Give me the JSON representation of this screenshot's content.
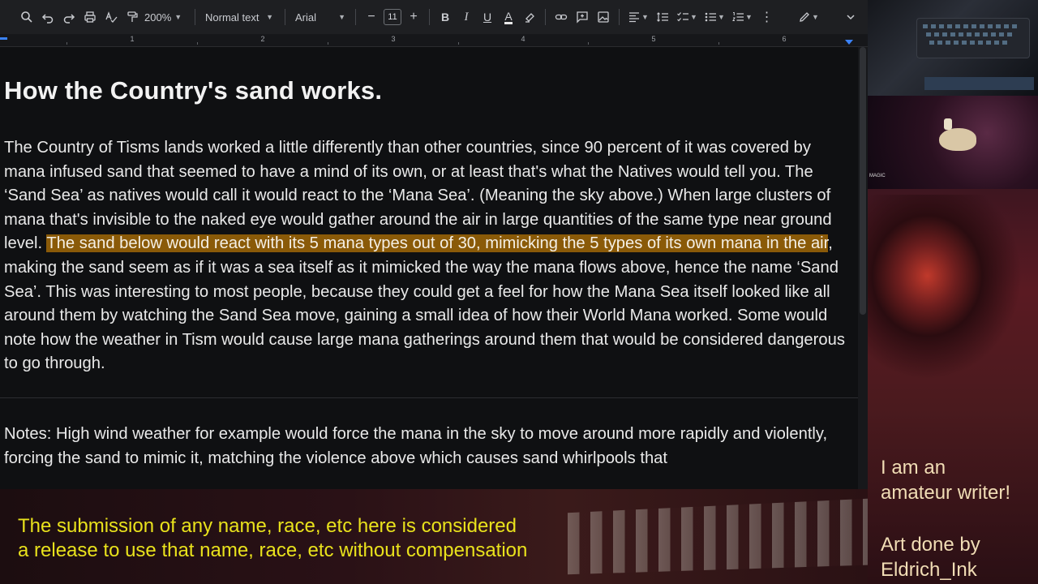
{
  "toolbar": {
    "zoom": "200%",
    "paragraph_style": "Normal text",
    "font": "Arial",
    "font_size": "11",
    "bold": "B",
    "italic": "I",
    "underline": "U",
    "text_color": "A",
    "icons": [
      "search-icon",
      "undo-icon",
      "redo-icon",
      "print-icon",
      "spellcheck-icon",
      "paint-format-icon",
      "highlight-icon",
      "link-icon",
      "comment-icon",
      "image-icon",
      "align-icon",
      "line-spacing-icon",
      "checklist-icon",
      "bullet-list-icon",
      "numbered-list-icon",
      "more-icon",
      "edit-mode-icon",
      "collapse-icon"
    ]
  },
  "ruler": {
    "numbers": [
      "1",
      "2",
      "3",
      "4",
      "5",
      "6"
    ]
  },
  "document": {
    "title": "How the Country's sand works.",
    "p1_before": "The Country of Tisms lands worked a little differently than other countries, since 90 percent of it was covered by mana infused sand that seemed to have a mind of its own, or at least that's what the Natives would tell you. The ‘Sand Sea’ as natives would call it would react to the ‘Mana Sea’. (Meaning the sky above.) When large clusters of mana that's invisible to the naked eye would gather around the air in large quantities of the same type near ground level. ",
    "p1_highlight": "The sand below would react with its 5 mana types out of 30, mimicking the 5 types of its own mana in the air",
    "p1_after": ", making the sand seem as if it was a sea itself as it mimicked the way the mana flows above, hence the name ‘Sand Sea’. This was interesting to most people, because they could get a feel for how the Mana Sea itself looked like all around them by watching the Sand Sea move, gaining a small idea of how their World Mana worked. Some would note how the weather in Tism would cause large mana gatherings around them that would be considered dangerous to go through.",
    "p2": "Notes: High wind weather for example would force the mana in the sky to move around more rapidly and violently, forcing the sand to mimic it, matching the violence above which causes sand whirlpools that"
  },
  "overlay": {
    "right_line1": "I am an",
    "right_line2": "amateur writer!",
    "right_line3": "Art done by",
    "right_line4": "Eldrich_Ink",
    "disclaimer_line1": "The submission of any name, race, etc here is considered",
    "disclaimer_line2": "a release to use that name, race, etc without compensation",
    "game_ui_text": "MAGIC"
  },
  "colors": {
    "highlight": "#8a5a08",
    "disclaimer": "#e9e21c",
    "accent": "#3b82f6"
  }
}
